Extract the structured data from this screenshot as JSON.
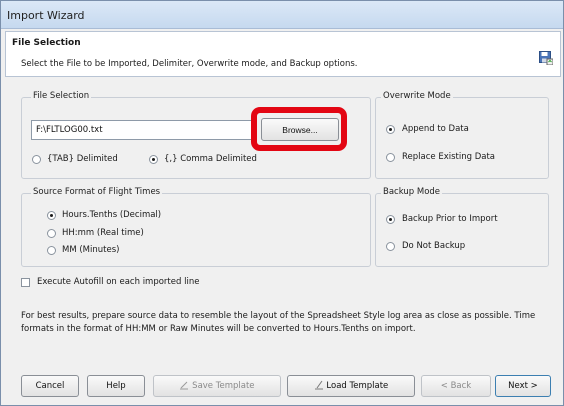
{
  "window": {
    "title": "Import Wizard"
  },
  "header": {
    "title": "File Selection",
    "description": "Select the File to be Imported, Delimiter, Overwrite mode, and Backup options.",
    "icon": "save-disk-icon"
  },
  "file_selection": {
    "legend": "File Selection",
    "path_value": "F:\\FLTLOG00.txt",
    "browse_label": "Browse...",
    "delimiters": [
      {
        "label": "{TAB} Delimited",
        "checked": false
      },
      {
        "label": "{,} Comma Delimited",
        "checked": true
      }
    ]
  },
  "overwrite_mode": {
    "legend": "Overwrite Mode",
    "options": [
      {
        "label": "Append to Data",
        "checked": true
      },
      {
        "label": "Replace Existing Data",
        "checked": false
      }
    ]
  },
  "source_format": {
    "legend": "Source Format of Flight Times",
    "options": [
      {
        "label": "Hours.Tenths (Decimal)",
        "checked": true
      },
      {
        "label": "HH:mm (Real time)",
        "checked": false
      },
      {
        "label": "MM (Minutes)",
        "checked": false
      }
    ]
  },
  "backup_mode": {
    "legend": "Backup Mode",
    "options": [
      {
        "label": "Backup Prior to Import",
        "checked": true
      },
      {
        "label": "Do Not Backup",
        "checked": false
      }
    ]
  },
  "autofill": {
    "label": "Execute Autofill on each imported line",
    "checked": false
  },
  "note": {
    "line1": "For best results, prepare source data to resemble the layout of the Spreadsheet Style log area as close as possible.  Time",
    "line2": "formats in the format of HH:MM or Raw Minutes will be converted to Hours.Tenths on import."
  },
  "buttons": {
    "cancel": "Cancel",
    "help": "Help",
    "save_template": "Save Template",
    "load_template": "Load Template",
    "back": "< Back",
    "next": "Next >"
  },
  "colors": {
    "highlight": "#e30613",
    "title_bar": "#c6d9ef"
  }
}
